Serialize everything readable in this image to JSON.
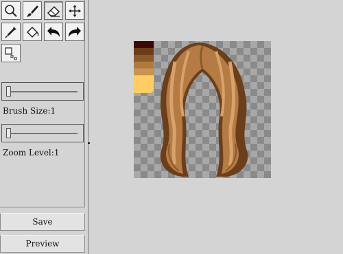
{
  "tools": [
    {
      "id": "zoom",
      "icon": "magnifier-icon"
    },
    {
      "id": "brush",
      "icon": "brush-icon"
    },
    {
      "id": "eraser",
      "icon": "eraser-icon",
      "active": true
    },
    {
      "id": "move",
      "icon": "move-icon"
    },
    {
      "id": "eyedropper",
      "icon": "eyedropper-icon"
    },
    {
      "id": "fill",
      "icon": "paint-bucket-icon"
    },
    {
      "id": "undo",
      "icon": "undo-arrow-icon"
    },
    {
      "id": "redo",
      "icon": "redo-arrow-icon"
    },
    {
      "id": "select",
      "icon": "selection-icon"
    }
  ],
  "brush_size": {
    "label": "Brush Size:1",
    "value": 1
  },
  "zoom_level": {
    "label": "Zoom Level:1",
    "value": 1
  },
  "buttons": {
    "save": "Save",
    "preview": "Preview"
  },
  "palette": {
    "colors": [
      "#3b0a05",
      "#6a3a1a",
      "#8a5a2a",
      "#b07a3e",
      "#c8954f",
      "#ffcc66"
    ]
  },
  "colors": {
    "panel_bg": "#d4d4d4",
    "checker_dark": "#8a8a8a",
    "checker_light": "#a8a8a8",
    "hair_dark": "#6b3f1c",
    "hair_mid": "#b47b45",
    "hair_light": "#d9a26a"
  }
}
